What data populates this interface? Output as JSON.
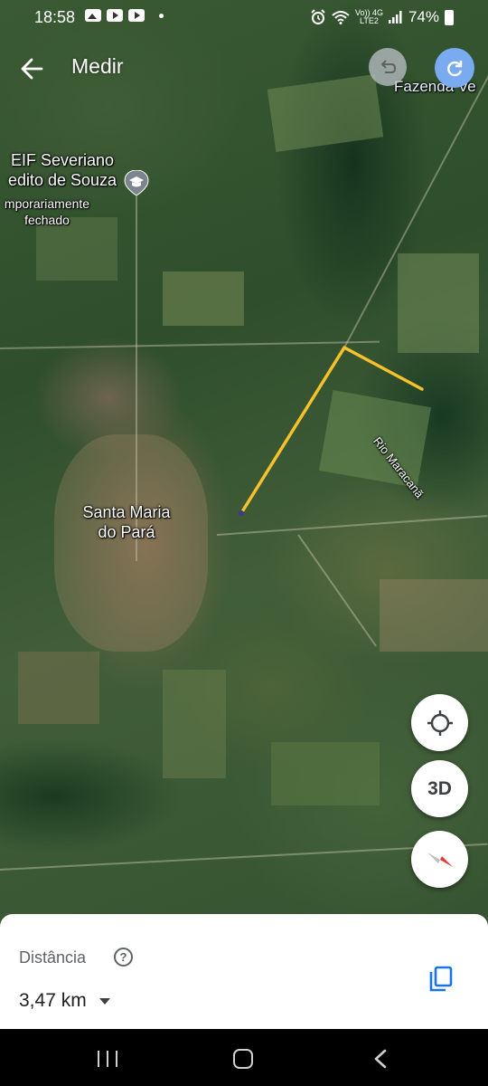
{
  "status_bar": {
    "time": "18:58",
    "network_top": "Vo)) 4G",
    "network_bottom": "LTE2",
    "battery": "74%"
  },
  "app_bar": {
    "title": "Medir",
    "back_icon": "arrow-back-icon",
    "undo_icon": "undo-icon",
    "redo_icon": "redo-icon"
  },
  "map": {
    "labels": {
      "school_line1": "EIF Severiano",
      "school_line2": "edito de Souza",
      "school_status_line1": "mporariamente",
      "school_status_line2": "fechado",
      "town_line1": "Santa Maria",
      "town_line2": "do Pará",
      "fazenda": "Fazenda Ve",
      "river": "Rio Maracanã"
    },
    "measure_line_color": "#f6c12b",
    "fabs": {
      "location_icon": "my-location-icon",
      "three_d_label": "3D",
      "compass_icon": "compass-icon"
    }
  },
  "bottom_sheet": {
    "distance_label": "Distância",
    "distance_value": "3,47 km",
    "help_icon": "help-icon",
    "copy_icon": "copy-icon",
    "accent": "#1a73e8"
  },
  "nav_bar": {
    "recents_icon": "recents-icon",
    "home_icon": "home-icon",
    "back_icon": "nav-back-icon"
  }
}
